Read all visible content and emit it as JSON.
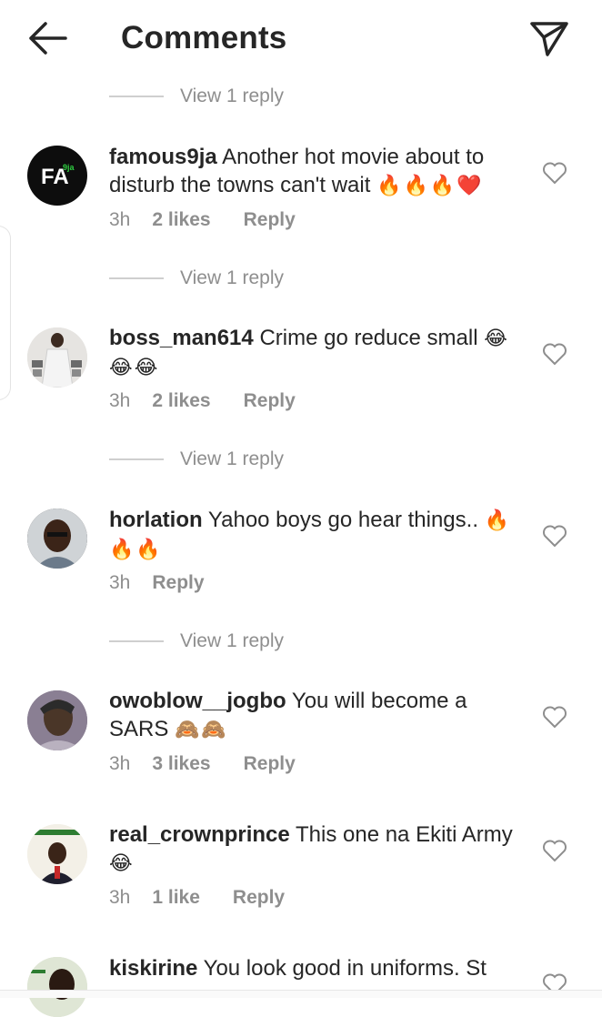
{
  "header": {
    "title": "Comments",
    "back_icon": "back-arrow-icon",
    "share_icon": "paper-plane-icon"
  },
  "view_reply_label": "View 1 reply",
  "comments": [
    {
      "username": "famous9ja",
      "text": "Another hot movie about to disturb the towns can't wait",
      "emoji": "🔥🔥🔥❤️",
      "time": "3h",
      "likes": "2 likes",
      "reply": "Reply"
    },
    {
      "username": "boss_man614",
      "text": "Crime go reduce small",
      "emoji": "😂😂😂",
      "time": "3h",
      "likes": "2 likes",
      "reply": "Reply"
    },
    {
      "username": "horlation",
      "text": "Yahoo boys go hear things..",
      "emoji": "🔥🔥🔥",
      "time": "3h",
      "likes": "",
      "reply": "Reply"
    },
    {
      "username": "owoblow__jogbo",
      "text": "You will become a SARS",
      "emoji": "🙈🙈",
      "time": "3h",
      "likes": "3 likes",
      "reply": "Reply"
    },
    {
      "username": "real_crownprince",
      "text": "This one na Ekiti Army",
      "emoji": "😂",
      "time": "3h",
      "likes": "1 like",
      "reply": "Reply"
    },
    {
      "username": "kiskirine",
      "text": "You look good in uniforms. St",
      "emoji": "",
      "time": "",
      "likes": "",
      "reply": ""
    }
  ],
  "avatar_logo": {
    "letters": "FA",
    "small": "9ja",
    "accent": "#2ecc40"
  },
  "colors": {
    "text": "#262626",
    "muted": "#8e8e8e",
    "heart": "#d9302b",
    "fire": "#ff7a1a"
  }
}
